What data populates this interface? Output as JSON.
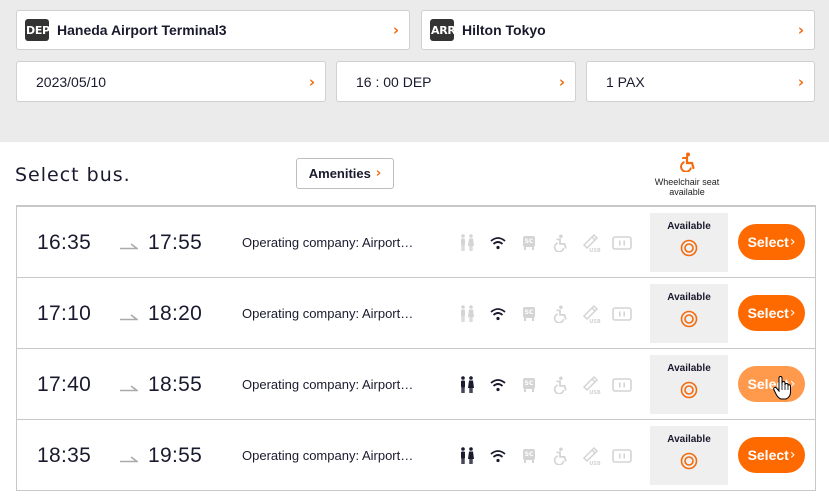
{
  "search": {
    "departure": {
      "badge": "DEP",
      "label": "Haneda Airport Terminal3"
    },
    "arrival": {
      "badge": "ARR",
      "label": "Hilton Tokyo"
    },
    "date": "2023/05/10",
    "time": "16 : 00 DEP",
    "pax": "1 PAX",
    "chevron": "›"
  },
  "header": {
    "title": "Select bus.",
    "amenities_button": "Amenities",
    "amenities_chevron": "›",
    "wheelchair_legend": "Wheelchair seat available"
  },
  "colors": {
    "accent": "#ff6a00",
    "accent_hover": "#ff9a4d",
    "chevron": "#f26b0f",
    "panel_bg": "#ebebeb"
  },
  "buses": [
    {
      "dep": "16:35",
      "arrow": "→",
      "arr": "17:55",
      "company": "Operating company: Airport…",
      "amenities": {
        "toilet": false,
        "wifi": true,
        "seat_charger": false,
        "wheelchair": false,
        "usb": false,
        "outlet": false
      },
      "availability": "Available",
      "availability_symbol": "◎",
      "select": "Select",
      "select_chevron": "›",
      "hovered": false
    },
    {
      "dep": "17:10",
      "arrow": "→",
      "arr": "18:20",
      "company": "Operating company: Airport…",
      "amenities": {
        "toilet": false,
        "wifi": true,
        "seat_charger": false,
        "wheelchair": false,
        "usb": false,
        "outlet": false
      },
      "availability": "Available",
      "availability_symbol": "◎",
      "select": "Select",
      "select_chevron": "›",
      "hovered": false
    },
    {
      "dep": "17:40",
      "arrow": "→",
      "arr": "18:55",
      "company": "Operating company: Airport…",
      "amenities": {
        "toilet": true,
        "wifi": true,
        "seat_charger": false,
        "wheelchair": false,
        "usb": false,
        "outlet": false
      },
      "availability": "Available",
      "availability_symbol": "◎",
      "select": "Select",
      "select_chevron": "›",
      "hovered": true
    },
    {
      "dep": "18:35",
      "arrow": "→",
      "arr": "19:55",
      "company": "Operating company: Airport…",
      "amenities": {
        "toilet": true,
        "wifi": true,
        "seat_charger": false,
        "wheelchair": false,
        "usb": false,
        "outlet": false
      },
      "availability": "Available",
      "availability_symbol": "◎",
      "select": "Select",
      "select_chevron": "›",
      "hovered": false
    }
  ]
}
